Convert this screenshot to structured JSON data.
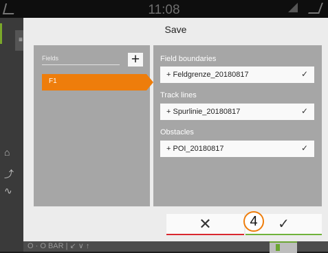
{
  "status_bar": {
    "time": "11:08"
  },
  "background": {
    "tab_label": "≡",
    "bottom_text": "O · O  BAR  | ↙      ∨                                    ↑"
  },
  "dialog": {
    "title": "Save",
    "fields_panel": {
      "header": "Fields",
      "add_label": "+",
      "items": [
        {
          "label": "F1",
          "selected": true
        }
      ]
    },
    "sections": [
      {
        "title": "Field boundaries",
        "item": "+ Feldgrenze_20180817",
        "check": "✓"
      },
      {
        "title": "Track lines",
        "item": "+ Spurlinie_20180817",
        "check": "✓"
      },
      {
        "title": "Obstacles",
        "item": "+ POI_20180817",
        "check": "✓"
      }
    ],
    "cancel_symbol": "✕",
    "ok_symbol": "✓",
    "callout_number": "4"
  },
  "colors": {
    "accent_orange": "#ee7d0b",
    "cancel_red": "#d9272f",
    "ok_green": "#6fb23a",
    "panel_gray": "#a6a6a6"
  }
}
